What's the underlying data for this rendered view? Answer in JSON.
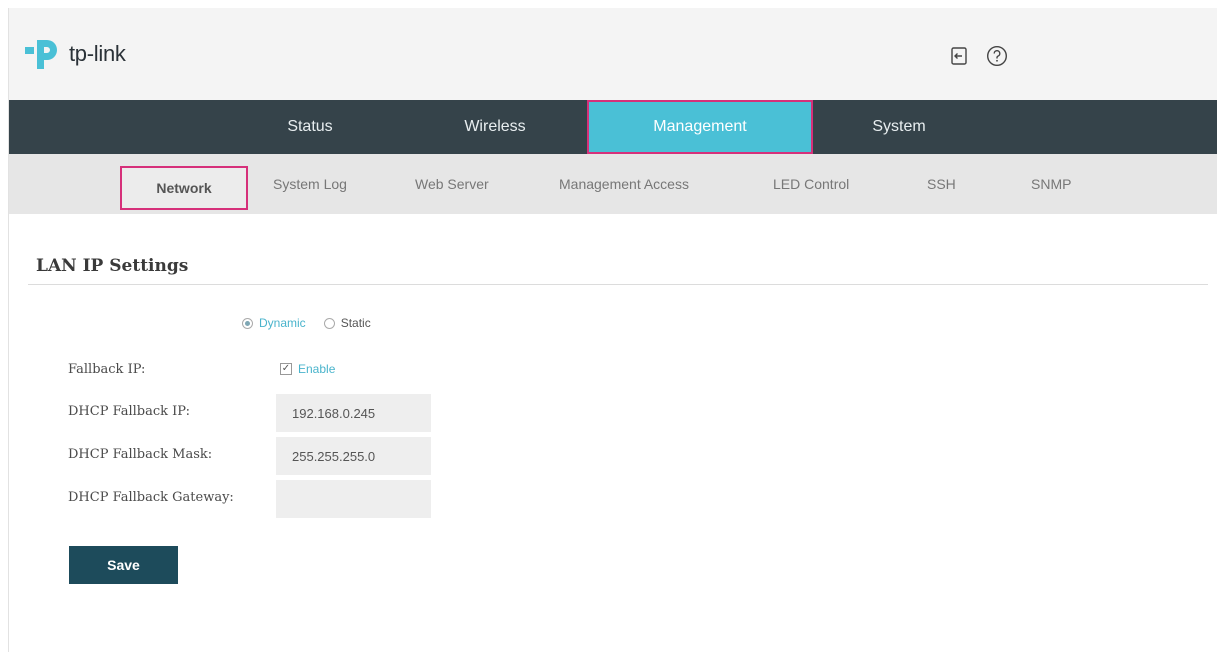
{
  "brand": {
    "name": "tp-link",
    "accent": "#4ac0d6",
    "highlight": "#d6307a"
  },
  "header": {
    "icons": [
      "logout-icon",
      "help-icon"
    ]
  },
  "main_nav": {
    "tabs": [
      {
        "label": "Status"
      },
      {
        "label": "Wireless"
      },
      {
        "label": "Management",
        "active": true
      },
      {
        "label": "System"
      }
    ]
  },
  "sub_nav": {
    "items": [
      {
        "label": "Network",
        "active": true
      },
      {
        "label": "System Log"
      },
      {
        "label": "Web Server"
      },
      {
        "label": "Management Access"
      },
      {
        "label": "LED Control"
      },
      {
        "label": "SSH"
      },
      {
        "label": "SNMP"
      }
    ]
  },
  "section": {
    "title": "LAN IP Settings"
  },
  "ip_mode": {
    "options": [
      {
        "label": "Dynamic",
        "selected": true
      },
      {
        "label": "Static",
        "selected": false
      }
    ]
  },
  "form": {
    "fallback_ip": {
      "label": "Fallback IP:",
      "checkbox_label": "Enable",
      "checked": true
    },
    "dhcp_fallback_ip": {
      "label": "DHCP Fallback IP:",
      "value": "192.168.0.245"
    },
    "dhcp_fallback_mask": {
      "label": "DHCP Fallback Mask:",
      "value": "255.255.255.0"
    },
    "dhcp_fallback_gateway": {
      "label": "DHCP Fallback Gateway:",
      "value": ""
    }
  },
  "actions": {
    "save_label": "Save"
  }
}
